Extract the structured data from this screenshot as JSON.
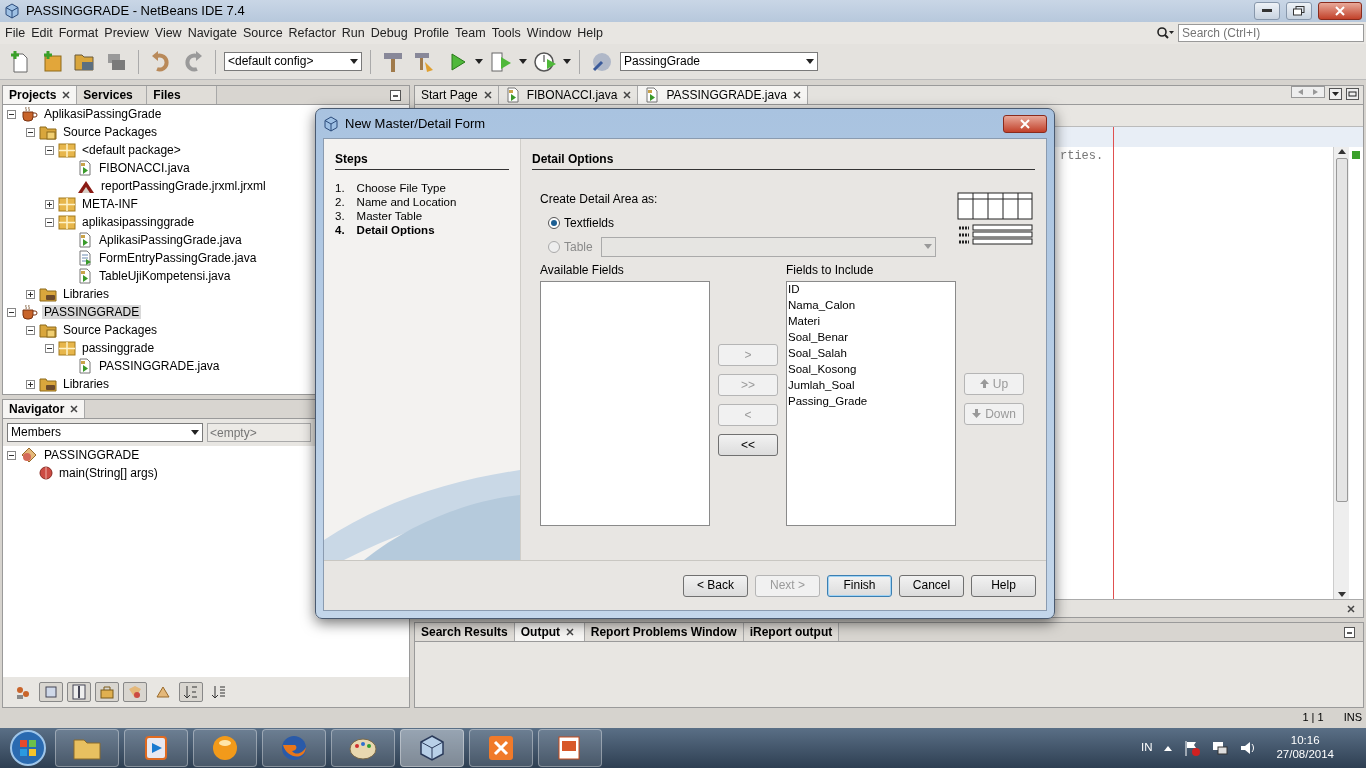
{
  "window": {
    "title": "PASSINGGRADE - NetBeans IDE 7.4"
  },
  "menu": [
    "File",
    "Edit",
    "Format",
    "Preview",
    "View",
    "Navigate",
    "Source",
    "Refactor",
    "Run",
    "Debug",
    "Profile",
    "Team",
    "Tools",
    "Window",
    "Help"
  ],
  "search": {
    "placeholder": "Search (Ctrl+I)"
  },
  "toolbar": {
    "config": "<default config>",
    "project": "PassingGrade"
  },
  "projects_panel": {
    "tabs": [
      {
        "label": "Projects",
        "selected": true,
        "closable": true
      },
      {
        "label": "Services",
        "selected": false,
        "closable": false
      },
      {
        "label": "Files",
        "selected": false,
        "closable": false
      }
    ],
    "tree": [
      {
        "label": "AplikasiPassingGrade",
        "kind": "project",
        "expanded": true,
        "selected": false,
        "children": [
          {
            "label": "Source Packages",
            "kind": "sources",
            "expanded": true,
            "selected": false,
            "children": [
              {
                "label": "<default package>",
                "kind": "package",
                "expanded": true,
                "selected": false,
                "children": [
                  {
                    "label": "FIBONACCI.java",
                    "kind": "java",
                    "selected": false
                  },
                  {
                    "label": "reportPassingGrade.jrxml.jrxml",
                    "kind": "report",
                    "selected": false
                  }
                ]
              },
              {
                "label": "META-INF",
                "kind": "package",
                "expanded": false,
                "selected": false
              },
              {
                "label": "aplikasipassinggrade",
                "kind": "package",
                "expanded": true,
                "selected": false,
                "children": [
                  {
                    "label": "AplikasiPassingGrade.java",
                    "kind": "java",
                    "selected": false
                  },
                  {
                    "label": "FormEntryPassingGrade.java",
                    "kind": "form",
                    "selected": false
                  },
                  {
                    "label": "TableUjiKompetensi.java",
                    "kind": "java",
                    "selected": false
                  }
                ]
              }
            ]
          },
          {
            "label": "Libraries",
            "kind": "libraries",
            "expanded": false,
            "selected": false
          }
        ]
      },
      {
        "label": "PASSINGGRADE",
        "kind": "project",
        "expanded": true,
        "selected": true,
        "children": [
          {
            "label": "Source Packages",
            "kind": "sources",
            "expanded": true,
            "selected": false,
            "children": [
              {
                "label": "passinggrade",
                "kind": "package",
                "expanded": true,
                "selected": false,
                "children": [
                  {
                    "label": "PASSINGGRADE.java",
                    "kind": "java",
                    "selected": false
                  }
                ]
              }
            ]
          },
          {
            "label": "Libraries",
            "kind": "libraries",
            "expanded": false,
            "selected": false
          }
        ]
      }
    ]
  },
  "navigator": {
    "title": "Navigator",
    "filter": "Members",
    "placeholder": "<empty>",
    "tree": [
      {
        "label": "PASSINGGRADE",
        "kind": "class",
        "expanded": true,
        "children": [
          {
            "label": "main(String[] args)",
            "kind": "method"
          }
        ]
      }
    ],
    "tools": [
      {
        "pressed": false
      },
      {
        "pressed": true
      },
      {
        "pressed": true
      },
      {
        "pressed": true
      },
      {
        "pressed": true
      },
      {
        "pressed": false
      },
      {
        "pressed": true
      },
      {
        "pressed": false
      }
    ]
  },
  "editor": {
    "tabs": [
      {
        "label": "Start Page",
        "kind": "page",
        "selected": false,
        "closable": true
      },
      {
        "label": "FIBONACCI.java",
        "kind": "java",
        "selected": false,
        "closable": true
      },
      {
        "label": "PASSINGGRADE.java",
        "kind": "java",
        "selected": true,
        "closable": true
      }
    ],
    "code_fragment": "rties."
  },
  "dialog": {
    "title": "New Master/Detail Form",
    "steps_title": "Steps",
    "steps": [
      {
        "number": "1.",
        "label": "Choose File Type",
        "selected": false
      },
      {
        "number": "2.",
        "label": "Name and Location",
        "selected": false
      },
      {
        "number": "3.",
        "label": "Master Table",
        "selected": false
      },
      {
        "number": "4.",
        "label": "Detail Options",
        "selected": true
      }
    ],
    "panel_title": "Detail Options",
    "detail_area_label": "Create Detail Area as:",
    "options": [
      {
        "label": "Textfields",
        "selected": true,
        "disabled": false,
        "kind": "radio"
      },
      {
        "label": "Table",
        "selected": false,
        "disabled": true,
        "kind": "radio-combo"
      }
    ],
    "available_label": "Available Fields",
    "include_label": "Fields to Include",
    "include": [
      "ID",
      "Nama_Calon",
      "Materi",
      "Soal_Benar",
      "Soal_Salah",
      "Soal_Kosong",
      "Jumlah_Soal",
      "Passing_Grade"
    ],
    "move_buttons": [
      {
        "label": ">",
        "disabled": true
      },
      {
        "label": ">>",
        "disabled": true
      },
      {
        "label": "<",
        "disabled": true
      },
      {
        "label": "<<",
        "disabled": false
      }
    ],
    "order_buttons": [
      {
        "label": "Up",
        "kind": "up",
        "disabled": true
      },
      {
        "label": "Down",
        "kind": "down",
        "disabled": true
      }
    ],
    "buttons": [
      {
        "label": "< Back",
        "disabled": false,
        "default": false
      },
      {
        "label": "Next >",
        "disabled": true,
        "default": false
      },
      {
        "label": "Finish",
        "disabled": false,
        "default": true
      },
      {
        "label": "Cancel",
        "disabled": false,
        "default": false
      },
      {
        "label": "Help",
        "disabled": false,
        "default": false
      }
    ]
  },
  "output_panel": {
    "tabs": [
      {
        "label": "Search Results",
        "selected": false,
        "closable": false
      },
      {
        "label": "Output",
        "selected": true,
        "closable": true
      },
      {
        "label": "Report Problems Window",
        "selected": false,
        "closable": false
      },
      {
        "label": "iReport output",
        "selected": false,
        "closable": false
      }
    ]
  },
  "status_bar": {
    "position": "1 | 1",
    "mode": "INS"
  },
  "taskbar": {
    "apps": [
      {
        "active": false
      },
      {
        "active": false
      },
      {
        "active": false
      },
      {
        "active": false
      },
      {
        "active": false
      },
      {
        "active": true
      },
      {
        "active": false
      },
      {
        "active": false
      }
    ],
    "language": "IN",
    "time": "10:16",
    "date": "27/08/2014"
  }
}
